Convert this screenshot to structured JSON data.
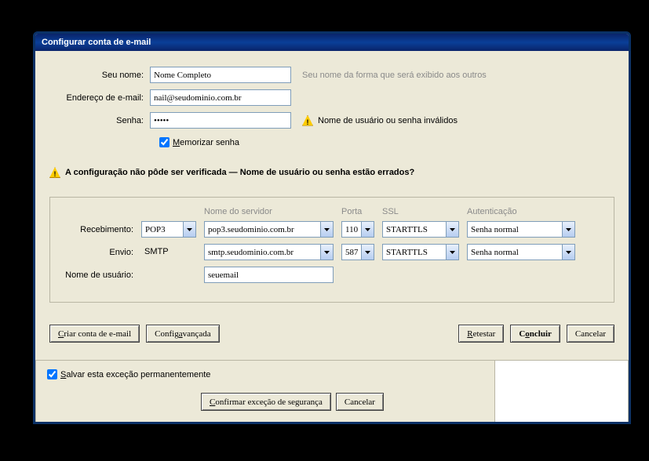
{
  "window": {
    "title": "Configurar conta de e-mail"
  },
  "fields": {
    "name_label": "Seu nome:",
    "name_value": "Nome Completo",
    "name_hint": "Seu nome da forma que será exibido aos outros",
    "email_label": "Endereço de e-mail:",
    "email_value": "nail@seudominio.com.br",
    "password_label": "Senha:",
    "password_value": "•••••",
    "password_warning": "Nome de usuário ou senha inválidos",
    "remember_label": "Memorizar senha",
    "remember_prefix": "M"
  },
  "error_message": "A configuração não pôde ser verificada — Nome de usuário ou senha estão errados?",
  "server_section": {
    "headers": {
      "server": "Nome do servidor",
      "port": "Porta",
      "ssl": "SSL",
      "auth": "Autenticação"
    },
    "incoming": {
      "label": "Recebimento:",
      "protocol": "POP3",
      "server": "pop3.seudominio.com.br",
      "port": "110",
      "ssl": "STARTTLS",
      "auth": "Senha normal"
    },
    "outgoing": {
      "label": "Envio:",
      "protocol": "SMTP",
      "server": "smtp.seudominio.com.br",
      "port": "587",
      "ssl": "STARTTLS",
      "auth": "Senha normal"
    },
    "username_label": "Nome de usuário:",
    "username_value": "seuemail"
  },
  "buttons": {
    "create": "Criar conta de e-mail",
    "advanced": "Config avançada",
    "retest": "Retestar",
    "finish": "Concluir",
    "cancel": "Cancelar"
  },
  "exception": {
    "save_label": "Salvar esta exceção permanentemente",
    "save_prefix": "S",
    "confirm": "Confirmar exceção de segurança",
    "cancel": "Cancelar"
  }
}
